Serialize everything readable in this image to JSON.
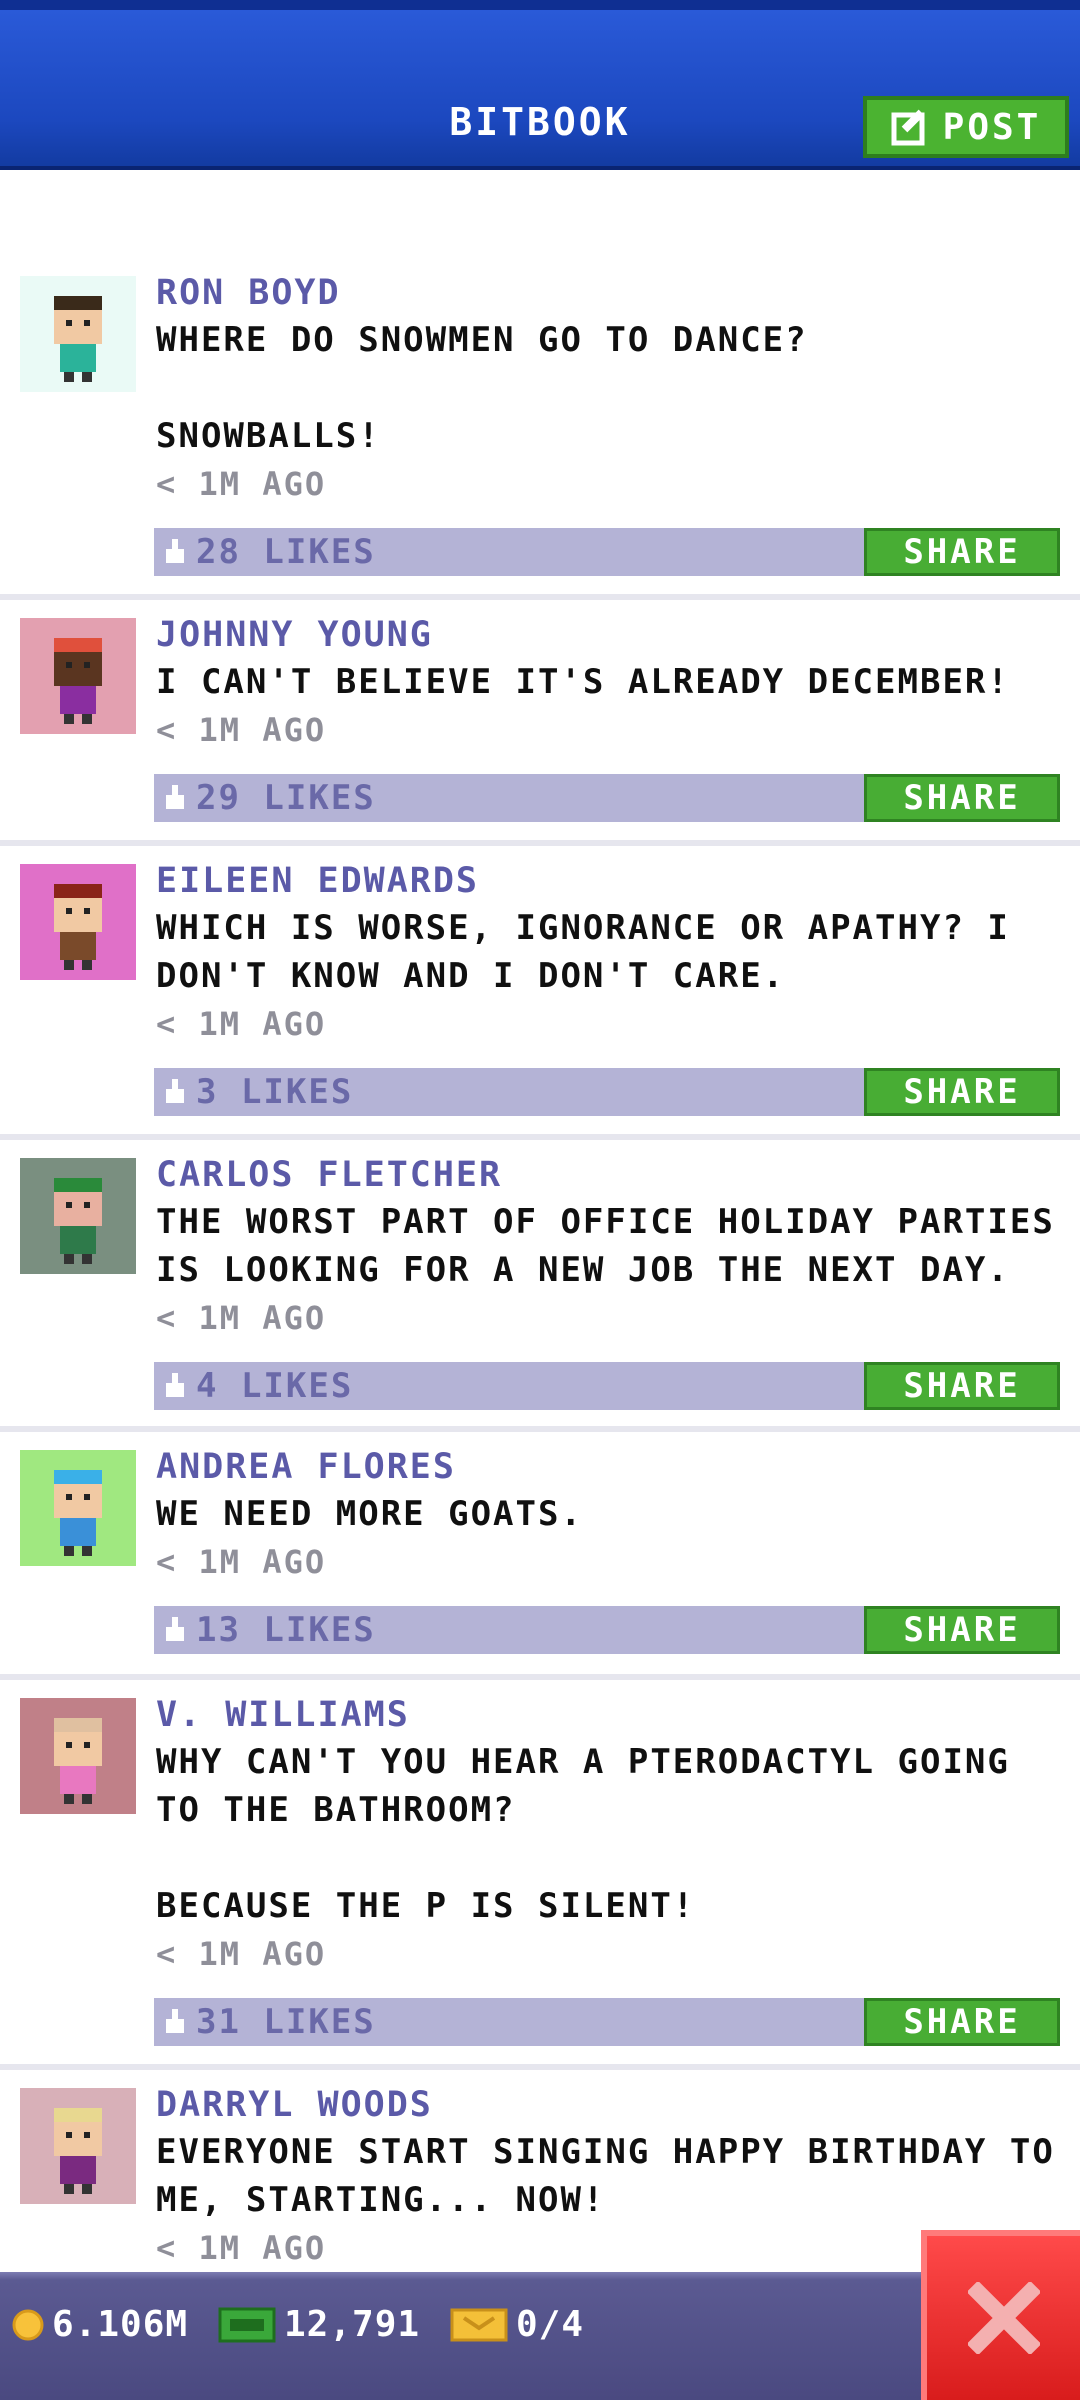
{
  "header": {
    "title": "BITBOOK",
    "post_label": "POST"
  },
  "posts": [
    {
      "name": "RON BOYD",
      "text": "WHERE DO SNOWMEN GO TO DANCE?\n\nSNOWBALLS!",
      "time": "< 1M AGO",
      "likes": "28 LIKES",
      "share": "SHARE",
      "avatar_bg": "#eafaf6",
      "skin": "#f1c9a3",
      "hair": "#3a2a1a",
      "shirt": "#2bb39a"
    },
    {
      "name": "JOHNNY YOUNG",
      "text": "I CAN'T BELIEVE IT'S ALREADY DECEMBER!",
      "time": "< 1M AGO",
      "likes": "29 LIKES",
      "share": "SHARE",
      "avatar_bg": "#e3a0b0",
      "skin": "#5a3520",
      "hair": "#e0503c",
      "shirt": "#8a2ea0"
    },
    {
      "name": "EILEEN EDWARDS",
      "text": "WHICH IS WORSE, IGNORANCE OR APATHY? I DON'T KNOW AND I DON'T CARE.",
      "time": "< 1M AGO",
      "likes": "3 LIKES",
      "share": "SHARE",
      "avatar_bg": "#e070c8",
      "skin": "#f1c9a3",
      "hair": "#8a2418",
      "shirt": "#7a4a2a"
    },
    {
      "name": "CARLOS FLETCHER",
      "text": "THE WORST PART OF OFFICE HOLIDAY PARTIES IS LOOKING FOR A NEW JOB THE NEXT DAY.",
      "time": "< 1M AGO",
      "likes": "4 LIKES",
      "share": "SHARE",
      "avatar_bg": "#7a8f80",
      "skin": "#e8b0a0",
      "hair": "#2a8a3a",
      "shirt": "#2e7a4a"
    },
    {
      "name": "ANDREA FLORES",
      "text": "WE NEED MORE GOATS.",
      "time": "< 1M AGO",
      "likes": "13 LIKES",
      "share": "SHARE",
      "avatar_bg": "#a0e880",
      "skin": "#f1c9a3",
      "hair": "#3ab0e8",
      "shirt": "#3a90d8"
    },
    {
      "name": "V. WILLIAMS",
      "text": "WHY CAN'T YOU HEAR A PTERODACTYL GOING TO THE BATHROOM?\n\nBECAUSE THE P IS SILENT!",
      "time": "< 1M AGO",
      "likes": "31 LIKES",
      "share": "SHARE",
      "avatar_bg": "#c08088",
      "skin": "#f1c9a3",
      "hair": "#e0c0a0",
      "shirt": "#e878c0"
    },
    {
      "name": "DARRYL WOODS",
      "text": "EVERYONE START SINGING HAPPY BIRTHDAY TO ME, STARTING... NOW!",
      "time": "< 1M AGO",
      "likes": "",
      "share": "",
      "avatar_bg": "#d8b0b8",
      "skin": "#f1c9a3",
      "hair": "#e8d890",
      "shirt": "#7a2a80"
    }
  ],
  "bottom": {
    "coins": "6.106M",
    "bux": "12,791",
    "tickets": "0/4"
  },
  "colors": {
    "accent_green": "#48ad34",
    "header_blue": "#1c48bf",
    "close_red": "#e02828"
  }
}
